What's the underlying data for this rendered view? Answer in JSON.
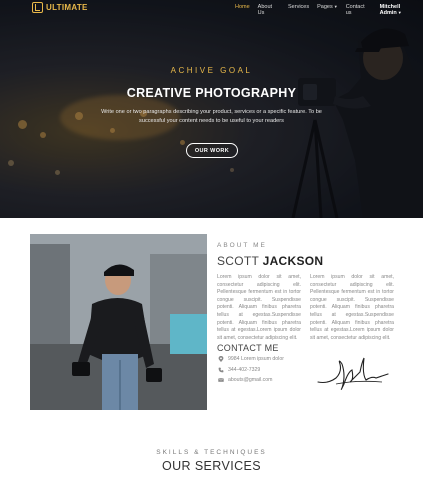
{
  "nav": {
    "logo_text": "ULTIMATE",
    "items": [
      {
        "label": "Home",
        "active": true
      },
      {
        "label": "About Us",
        "active": false
      },
      {
        "label": "Services",
        "active": false
      },
      {
        "label": "Pages",
        "active": false,
        "dropdown": true
      },
      {
        "label": "Contact us",
        "active": false
      }
    ],
    "user_label": "Mitchell Admin"
  },
  "hero": {
    "subtitle": "ACHIVE GOAL",
    "title": "CREATIVE PHOTOGRAPHY",
    "description": "Write one or two paragraphs describing your product, services or a specific feature. To be successful your content needs to be useful to your readers",
    "button_label": "OUR WORK"
  },
  "about": {
    "label": "ABOUT ME",
    "first_name": "SCOTT",
    "last_name": "JACKSON",
    "paragraph1": "Lorem ipsum dolor sit amet, consectetur adipiscing elit. Pellentesque fermentum est in tortor congue suscipit. Suspendisse potenti. Aliquam finibus pharetra tellus at egestas.Suspendisse potenti. Aliquam finibus pharetra tellus at egestas.Lorem ipsum dolor sit amet, consectetur adipiscing elit.",
    "paragraph2": "Lorem ipsum dolor sit amet, consectetur adipiscing elit. Pellentesque fermentum est in tortor congue suscipit. Suspendisse potenti. Aliquam finibus pharetra tellus at egestas.Suspendisse potenti. Aliquam finibus pharetra tellus at egestas.Lorem ipsum dolor sit amet, consectetur adipiscing elit.",
    "contact_title": "CONTACT ME",
    "address": "9984 Lorem ipsum dolor",
    "phone": "344-402-7329",
    "email": "abouts@gmail.com"
  },
  "services": {
    "label": "SKILLS & TECHNIQUES",
    "title": "OUR SERVICES"
  },
  "colors": {
    "accent": "#e9b94a",
    "hero_bg": "#15181f",
    "text_muted": "#888888"
  }
}
